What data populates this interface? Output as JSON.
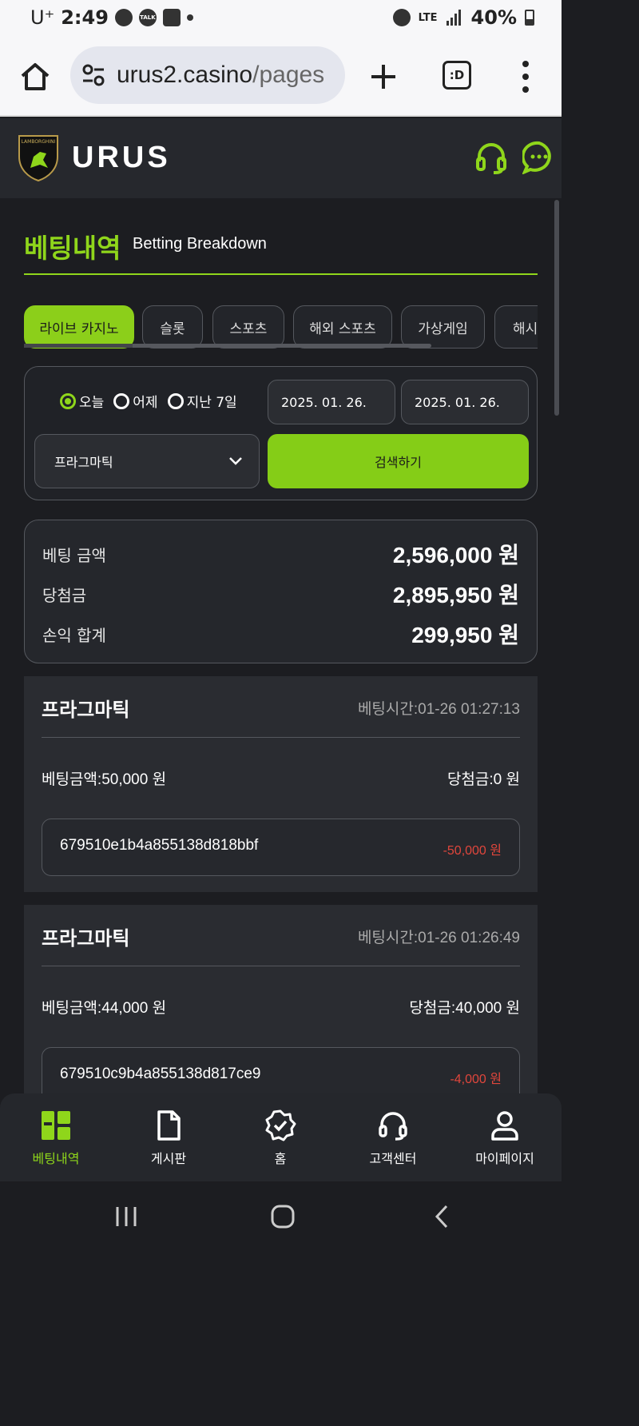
{
  "status_bar": {
    "carrier": "U⁺",
    "time": "2:49",
    "kakao_badge": "TALK",
    "network": "LTE",
    "battery": "40%"
  },
  "browser": {
    "url_domain": "urus2.casino",
    "url_path": "/pages",
    "tabs_count_label": ":D"
  },
  "header": {
    "logo_text": "LAMBORGHINI",
    "brand": "URUS"
  },
  "page": {
    "title": "베팅내역",
    "subtitle": "Betting Breakdown"
  },
  "tabs": [
    {
      "label": "라이브 카지노",
      "active": true
    },
    {
      "label": "슬롯",
      "active": false
    },
    {
      "label": "스포츠",
      "active": false
    },
    {
      "label": "해외 스포츠",
      "active": false
    },
    {
      "label": "가상게임",
      "active": false
    },
    {
      "label": "해시",
      "active": false
    }
  ],
  "filter": {
    "radio_options": [
      {
        "label": "오늘",
        "selected": true
      },
      {
        "label": "어제",
        "selected": false
      },
      {
        "label": "지난 7일",
        "selected": false
      }
    ],
    "date_from": "2025. 01. 26.",
    "date_to": "2025. 01. 26.",
    "provider_selected": "프라그마틱",
    "search_label": "검색하기"
  },
  "summary": {
    "bet_label": "베팅 금액",
    "bet_value": "2,596,000 원",
    "win_label": "당첨금",
    "win_value": "2,895,950 원",
    "pl_label": "손익 합계",
    "pl_value": "299,950 원"
  },
  "bets": [
    {
      "game": "프라그마틱",
      "time": "베팅시간:01-26 01:27:13",
      "amount": "베팅금액:50,000 원",
      "win": "당첨금:0 원",
      "id": "679510e1b4a855138d818bbf",
      "pl": "-50,000 원"
    },
    {
      "game": "프라그마틱",
      "time": "베팅시간:01-26 01:26:49",
      "amount": "베팅금액:44,000 원",
      "win": "당첨금:40,000 원",
      "id": "679510c9b4a855138d817ce9",
      "pl": "-4,000 원"
    }
  ],
  "bottom_nav": [
    {
      "label": "베팅내역",
      "icon": "betting-history-icon",
      "active": true
    },
    {
      "label": "게시판",
      "icon": "document-icon",
      "active": false
    },
    {
      "label": "홈",
      "icon": "badge-check-icon",
      "active": false
    },
    {
      "label": "고객센터",
      "icon": "headset-icon",
      "active": false
    },
    {
      "label": "마이페이지",
      "icon": "user-icon",
      "active": false
    }
  ],
  "colors": {
    "accent": "#8fd61b",
    "background": "#1c1d21",
    "card": "#2a2c31",
    "loss": "#e0463c"
  }
}
